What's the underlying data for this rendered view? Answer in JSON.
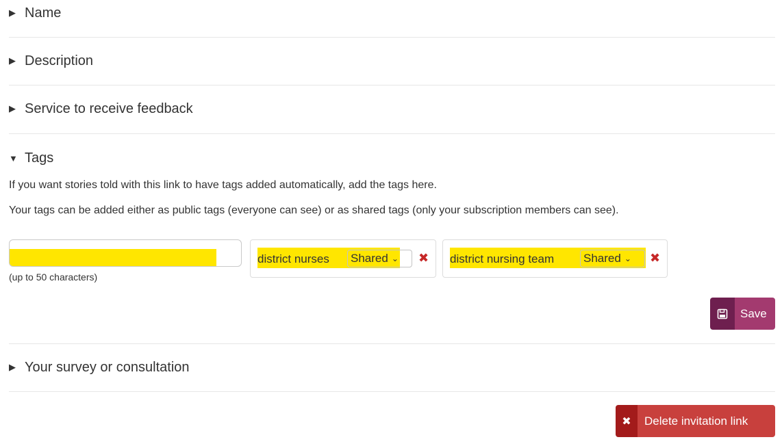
{
  "sections": {
    "name": {
      "label": "Name",
      "arrow": "▶"
    },
    "description": {
      "label": "Description",
      "arrow": "▶"
    },
    "service": {
      "label": "Service to receive feedback",
      "arrow": "▶"
    },
    "tags": {
      "label": "Tags",
      "arrow": "▼"
    },
    "survey": {
      "label": "Your survey or consultation",
      "arrow": "▶"
    }
  },
  "tags": {
    "intro": "If you want stories told with this link to have tags added automatically, add the tags here.",
    "explanation": "Your tags can be added either as public tags (everyone can see) or as shared tags (only your subscription members can see).",
    "input_value": "",
    "input_hint": "(up to 50 characters)",
    "items": [
      {
        "label": "district nurses",
        "visibility": "Shared",
        "remove": "✖"
      },
      {
        "label": "district nursing team",
        "visibility": "Shared",
        "remove": "✖"
      }
    ],
    "highlight_color": "#ffe600"
  },
  "buttons": {
    "save": {
      "icon": "save-icon",
      "label": "Save"
    },
    "delete": {
      "icon": "✖",
      "label": "Delete invitation link"
    }
  },
  "colors": {
    "save_dark": "#6e1f4f",
    "save_light": "#a33a6f",
    "delete_dark": "#a31b1b",
    "delete_light": "#c8403d",
    "remove_icon": "#c62828"
  }
}
